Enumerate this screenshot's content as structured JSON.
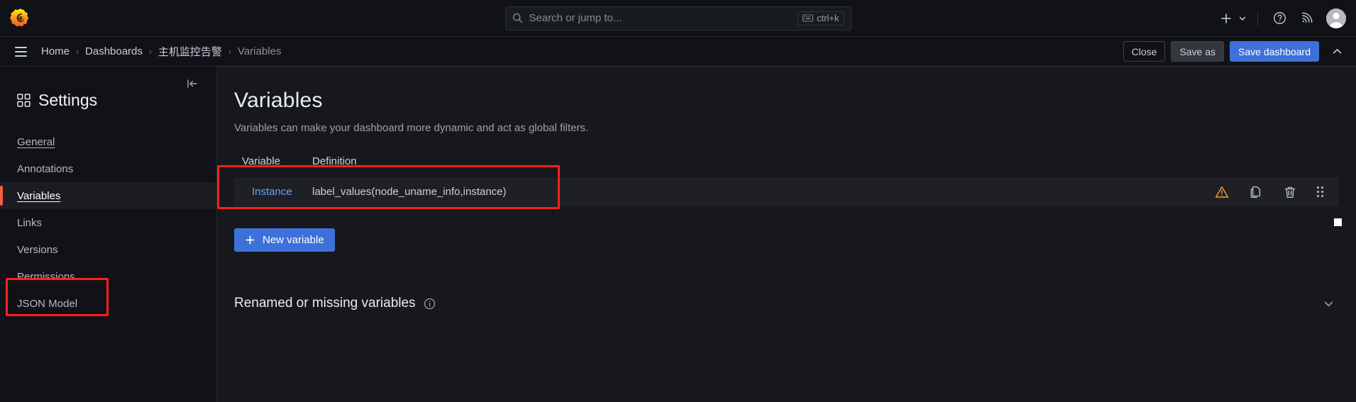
{
  "topbar": {
    "logo_icon": "grafana-logo",
    "search": {
      "icon": "search-icon",
      "placeholder": "Search or jump to...",
      "value": "",
      "shortcut": "ctrl+k",
      "shortcut_icon": "keyboard-icon"
    },
    "actions": {
      "add_icon": "plus-icon",
      "add_chevron_icon": "chevron-down-icon",
      "help_icon": "help-circle-icon",
      "news_icon": "rss-feed-icon",
      "avatar_icon": "user-avatar"
    }
  },
  "breadcrumb_bar": {
    "menu_icon": "hamburger-menu-icon",
    "crumbs": [
      {
        "label": "Home",
        "current": false
      },
      {
        "label": "Dashboards",
        "current": false
      },
      {
        "label": "主机监控告警",
        "current": false
      },
      {
        "label": "Variables",
        "current": true
      }
    ],
    "separator": "›",
    "buttons": {
      "close": "Close",
      "save_as": "Save as",
      "save_dashboard": "Save dashboard"
    },
    "collapse_icon": "chevron-up-icon"
  },
  "sidebar": {
    "collapse_icon": "collapse-left-icon",
    "title": "Settings",
    "title_icon": "apps-grid-icon",
    "items": [
      {
        "label": "General",
        "state": "hovered"
      },
      {
        "label": "Annotations",
        "state": "default"
      },
      {
        "label": "Variables",
        "state": "active"
      },
      {
        "label": "Links",
        "state": "default"
      },
      {
        "label": "Versions",
        "state": "default"
      },
      {
        "label": "Permissions",
        "state": "default"
      },
      {
        "label": "JSON Model",
        "state": "default"
      }
    ]
  },
  "main": {
    "title": "Variables",
    "description": "Variables can make your dashboard more dynamic and act as global filters.",
    "table": {
      "columns": [
        "Variable",
        "Definition"
      ],
      "rows": [
        {
          "variable": "Instance",
          "definition": "label_values(node_uname_info,instance)",
          "actions": {
            "warning_icon": "warning-triangle-icon",
            "duplicate_icon": "duplicate-icon",
            "delete_icon": "trash-icon",
            "drag_icon": "drag-handle-icon"
          }
        }
      ]
    },
    "new_variable_button": {
      "label": "New variable",
      "icon": "plus-icon"
    },
    "renamed_section": {
      "title": "Renamed or missing variables",
      "info_icon": "info-circle-icon",
      "expand_icon": "chevron-down-icon"
    }
  },
  "colors": {
    "accent_blue": "#3d71d9",
    "link_blue": "#6e9fff",
    "active_orange": "#f55f3e",
    "warning_orange": "#ff9830",
    "annotation_red": "#ff1f1f",
    "page_bg": "#111217",
    "panel_bg": "#16181d"
  }
}
